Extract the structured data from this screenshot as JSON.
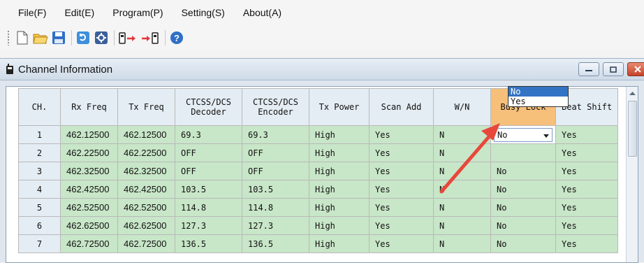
{
  "menubar": {
    "items": [
      "File(F)",
      "Edit(E)",
      "Program(P)",
      "Setting(S)",
      "About(A)"
    ]
  },
  "toolbar": {
    "icons": [
      "new-file-icon",
      "open-folder-icon",
      "save-icon",
      "read-radio-icon",
      "write-radio-icon",
      "radio-to-pc-icon",
      "pc-to-radio-icon",
      "help-icon"
    ]
  },
  "child_window": {
    "title": "Channel Information"
  },
  "table": {
    "headers": [
      "CH.",
      "Rx Freq",
      "Tx Freq",
      "CTCSS/DCS Decoder",
      "CTCSS/DCS Encoder",
      "Tx Power",
      "Scan Add",
      "W/N",
      "Busy Lock",
      "Beat Shift"
    ],
    "rows": [
      [
        "1",
        "462.12500",
        "462.12500",
        "69.3",
        "69.3",
        "High",
        "Yes",
        "N",
        "No",
        "Yes"
      ],
      [
        "2",
        "462.22500",
        "462.22500",
        "OFF",
        "OFF",
        "High",
        "Yes",
        "N",
        "",
        "Yes"
      ],
      [
        "3",
        "462.32500",
        "462.32500",
        "OFF",
        "OFF",
        "High",
        "Yes",
        "N",
        "No",
        "Yes"
      ],
      [
        "4",
        "462.42500",
        "462.42500",
        "103.5",
        "103.5",
        "High",
        "Yes",
        "N",
        "No",
        "Yes"
      ],
      [
        "5",
        "462.52500",
        "462.52500",
        "114.8",
        "114.8",
        "High",
        "Yes",
        "N",
        "No",
        "Yes"
      ],
      [
        "6",
        "462.62500",
        "462.62500",
        "127.3",
        "127.3",
        "High",
        "Yes",
        "N",
        "No",
        "Yes"
      ],
      [
        "7",
        "462.72500",
        "462.72500",
        "136.5",
        "136.5",
        "High",
        "Yes",
        "N",
        "No",
        "Yes"
      ]
    ]
  },
  "busy_lock_dropdown": {
    "value": "No",
    "options": [
      "No",
      "Yes"
    ],
    "highlighted": "No"
  },
  "colors": {
    "cell_green": "#c8e6c8",
    "header_highlight": "#f6c07a",
    "arrow": "#e8483a",
    "selection": "#3373c4"
  }
}
